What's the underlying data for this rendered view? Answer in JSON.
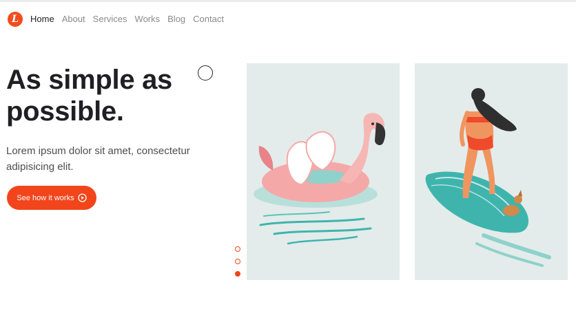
{
  "brand": {
    "logo_letter": "L",
    "accent": "#f2451b"
  },
  "nav": {
    "items": [
      {
        "label": "Home",
        "active": true
      },
      {
        "label": "About",
        "active": false
      },
      {
        "label": "Services",
        "active": false
      },
      {
        "label": "Works",
        "active": false
      },
      {
        "label": "Blog",
        "active": false
      },
      {
        "label": "Contact",
        "active": false
      }
    ]
  },
  "hero": {
    "headline_line1": "As simple as",
    "headline_line2": "possible.",
    "subtext": "Lorem ipsum dolor sit amet, consectetur adipisicing elit.",
    "cta_label": "See how it works",
    "cta_icon": "play-circle-icon"
  },
  "slider": {
    "count": 3,
    "active_index": 2
  },
  "illustrations": [
    {
      "icon": "flamingo-float-illustration"
    },
    {
      "icon": "surfer-girl-dog-illustration"
    }
  ]
}
